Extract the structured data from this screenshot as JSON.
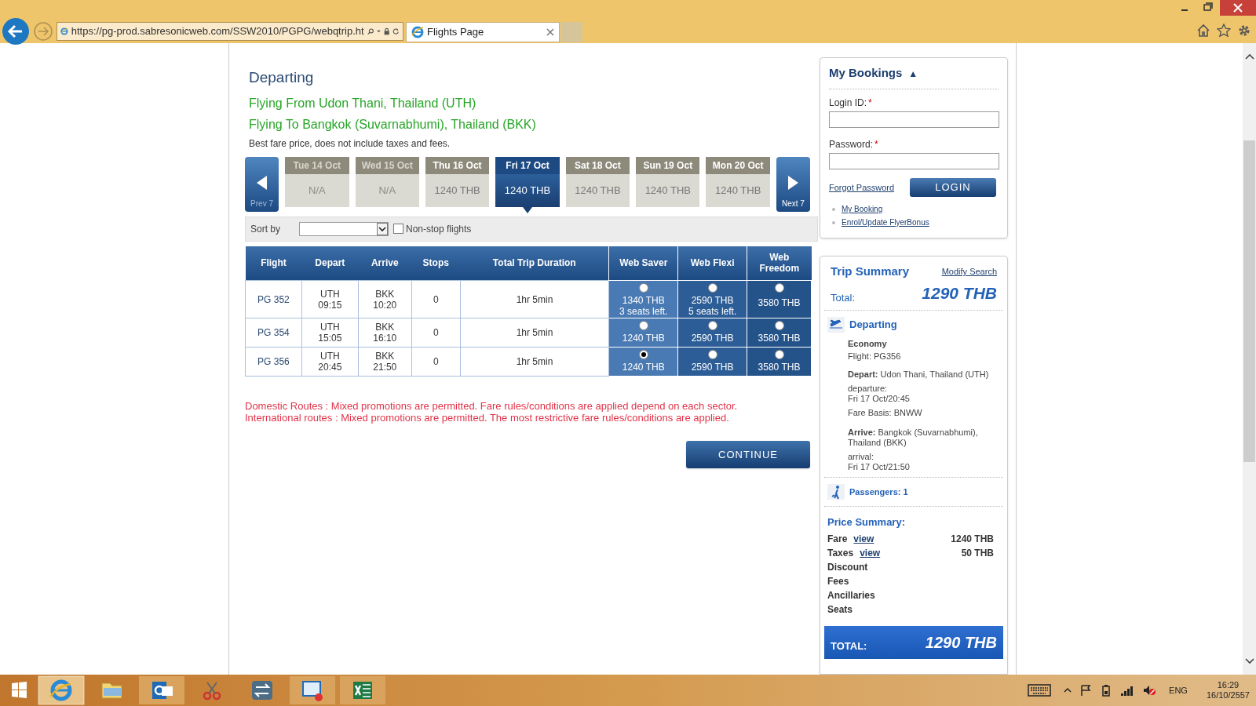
{
  "browser": {
    "address": "https://pg-prod.sabresonicweb.com/SSW2010/PGPG/webqtrip.ht",
    "tab_title": "Flights Page"
  },
  "main": {
    "heading": "Departing",
    "from": "Flying From Udon Thani, Thailand (UTH)",
    "to": "Flying To Bangkok (Suvarnabhumi), Thailand (BKK)",
    "note": "Best fare price, does not include taxes and fees.",
    "prev_label": "Prev 7",
    "next_label": "Next 7",
    "dates": [
      {
        "label": "Tue 14 Oct",
        "price": "N/A",
        "available": false,
        "selected": false
      },
      {
        "label": "Wed 15 Oct",
        "price": "N/A",
        "available": false,
        "selected": false
      },
      {
        "label": "Thu 16 Oct",
        "price": "1240 THB",
        "available": true,
        "selected": false
      },
      {
        "label": "Fri 17 Oct",
        "price": "1240 THB",
        "available": true,
        "selected": true
      },
      {
        "label": "Sat 18 Oct",
        "price": "1240 THB",
        "available": true,
        "selected": false
      },
      {
        "label": "Sun 19 Oct",
        "price": "1240 THB",
        "available": true,
        "selected": false
      },
      {
        "label": "Mon 20 Oct",
        "price": "1240 THB",
        "available": true,
        "selected": false
      }
    ],
    "sort_label": "Sort by",
    "nonstop": {
      "label": "Non-stop flights",
      "checked": false
    },
    "columns": [
      "Flight",
      "Depart",
      "Arrive",
      "Stops",
      "Total Trip Duration",
      "Web Saver",
      "Web Flexi",
      "Web Freedom"
    ],
    "rows": [
      {
        "flight": "PG 352",
        "depart_code": "UTH",
        "depart_time": "09:15",
        "arrive_code": "BKK",
        "arrive_time": "10:20",
        "stops": "0",
        "duration": "1hr 5min",
        "fares": [
          {
            "price": "1340 THB",
            "seats": "3 seats left.",
            "selected": false
          },
          {
            "price": "2590 THB",
            "seats": "5 seats left.",
            "selected": false
          },
          {
            "price": "3580 THB",
            "selected": false
          }
        ]
      },
      {
        "flight": "PG 354",
        "depart_code": "UTH",
        "depart_time": "15:05",
        "arrive_code": "BKK",
        "arrive_time": "16:10",
        "stops": "0",
        "duration": "1hr 5min",
        "fares": [
          {
            "price": "1240 THB",
            "selected": false
          },
          {
            "price": "2590 THB",
            "selected": false
          },
          {
            "price": "3580 THB",
            "selected": false
          }
        ]
      },
      {
        "flight": "PG 356",
        "depart_code": "UTH",
        "depart_time": "20:45",
        "arrive_code": "BKK",
        "arrive_time": "21:50",
        "stops": "0",
        "duration": "1hr 5min",
        "fares": [
          {
            "price": "1240 THB",
            "selected": true
          },
          {
            "price": "2590 THB",
            "selected": false
          },
          {
            "price": "3580 THB",
            "selected": false
          }
        ]
      }
    ],
    "notices": [
      "Domestic Routes : Mixed promotions are permitted. Fare rules/conditions are applied depend on each sector.",
      "International routes : Mixed promotions are permitted. The most restrictive fare rules/conditions are applied."
    ],
    "continue": "CONTINUE"
  },
  "bookings": {
    "title": "My Bookings",
    "collapse_glyph": "▲",
    "login_label": "Login ID:",
    "password_label": "Password:",
    "required_mark": "*",
    "forgot": "Forgot Password",
    "login": "LOGIN",
    "links": [
      "My Booking",
      "Enrol/Update FlyerBonus"
    ]
  },
  "trip": {
    "title": "Trip Summary",
    "modify": "Modify Search",
    "total_label": "Total:",
    "total": "1290 THB",
    "departing": "Departing",
    "cabin": "Economy",
    "flight": "Flight: PG356",
    "depart": "**Depart:** Udon Thani, Thailand (UTH)",
    "departure_label": "departure:",
    "departure": "Fri 17 Oct/20:45",
    "fare_basis": "Fare Basis: BNWW",
    "arrive": "**Arrive:** Bangkok (Suvarnabhumi), Thailand (BKK)",
    "arrival_label": "arrival:",
    "arrival": "Fri 17 Oct/21:50",
    "passengers": "Passengers: 1",
    "price_title": "Price Summary:",
    "prices": [
      {
        "label": "Fare",
        "link": "view",
        "amount": "1240 THB"
      },
      {
        "label": "Taxes",
        "link": "view",
        "amount": "50 THB"
      },
      {
        "label": "Discount"
      },
      {
        "label": "Fees"
      },
      {
        "label": "Ancillaries"
      },
      {
        "label": "Seats"
      }
    ],
    "grand_label": "TOTAL:",
    "grand_total": "1290 THB"
  },
  "taskbar": {
    "language": "ENG",
    "time": "16:29",
    "date": "16/10/2557"
  }
}
